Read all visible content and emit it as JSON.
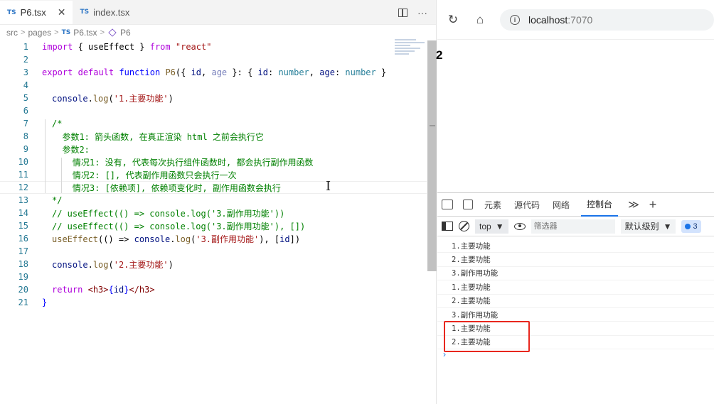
{
  "editor": {
    "tabs": [
      {
        "badge": "TS",
        "label": "P6.tsx",
        "close": "✕"
      },
      {
        "badge": "TS",
        "label": "index.tsx"
      }
    ],
    "more_icon": "···",
    "breadcrumb": {
      "parts": [
        "src",
        "pages"
      ],
      "file_badge": "TS",
      "file": "P6.tsx",
      "symbol": "P6"
    },
    "line_numbers": [
      "1",
      "2",
      "3",
      "4",
      "5",
      "6",
      "7",
      "8",
      "9",
      "10",
      "11",
      "12",
      "13",
      "14",
      "15",
      "16",
      "17",
      "18",
      "19",
      "20",
      "21"
    ]
  },
  "code": {
    "l1": {
      "import": "import",
      "body": " { useEffect } ",
      "from": "from",
      "mod": "\"react\""
    },
    "l3": {
      "export": "export",
      "default": "default",
      "function": "function",
      "name": "P6",
      "open": "({ ",
      "p1": "id",
      "comma": ", ",
      "p2": "age",
      "mid": " }: { ",
      "p1b": "id",
      "c1": ": ",
      "t1": "number",
      "sep": ", ",
      "p2b": "age",
      "c2": ": ",
      "t2": "number",
      "close": " }"
    },
    "l5": {
      "obj": "console",
      "dot": ".",
      "fn": "log",
      "open": "(",
      "str": "'1.主要功能'",
      "close": ")"
    },
    "l7": "/*",
    "l8": "  参数1: 箭头函数, 在真正渲染 html 之前会执行它",
    "l9": "  参数2:",
    "l10": "    情况1: 没有, 代表每次执行组件函数时, 都会执行副作用函数",
    "l11": "    情况2: [], 代表副作用函数只会执行一次",
    "l12": "    情况3: [依赖项], 依赖项变化时, 副作用函数会执行",
    "l13": "*/",
    "l14": "// useEffect(() => console.log('3.副作用功能'))",
    "l15": "// useEffect(() => console.log('3.副作用功能'), [])",
    "l16": {
      "fn": "useEffect",
      "a": "(() => ",
      "obj": "console",
      "dot": ".",
      "log": "log",
      "o": "(",
      "str": "'3.副作用功能'",
      "b": "), [",
      "dep": "id",
      "c": "])"
    },
    "l18": {
      "obj": "console",
      "dot": ".",
      "fn": "log",
      "open": "(",
      "str": "'2.主要功能'",
      "close": ")"
    },
    "l20": {
      "ret": "return",
      "t1": "<h3>",
      "expr_open": "{",
      "expr": "id",
      "expr_close": "}",
      "t2": "</h3>"
    },
    "l21": "}"
  },
  "browser": {
    "url_host": "localhost",
    "url_port": ":7070",
    "page_text": "2"
  },
  "devtools": {
    "tabs": [
      "元素",
      "源代码",
      "网络",
      "控制台"
    ],
    "more": "≫",
    "plus": "+",
    "context": "top",
    "filter_placeholder": "筛选器",
    "level": "默认级别",
    "issues_count": "3",
    "logs": [
      "1.主要功能",
      "2.主要功能",
      "3.副作用功能",
      "1.主要功能",
      "2.主要功能",
      "3.副作用功能",
      "1.主要功能",
      "2.主要功能"
    ],
    "prompt": "›"
  },
  "colors": {
    "highlight_box": "#e8271e",
    "accent": "#1a73e8"
  }
}
